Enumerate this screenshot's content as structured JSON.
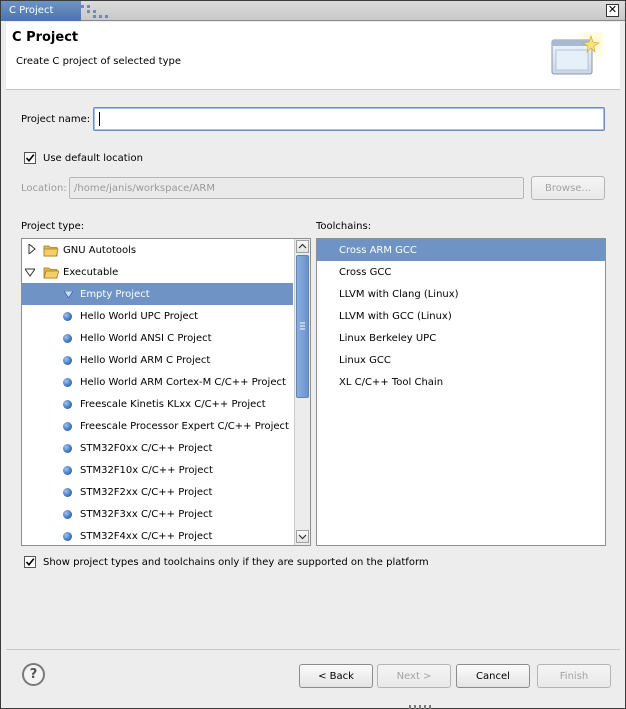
{
  "window": {
    "title": "C Project",
    "close_glyph": "✕"
  },
  "header": {
    "title": "C Project",
    "description": "Create C project of selected type",
    "banner_icon": "wizard-banner-icon"
  },
  "form": {
    "project_name_label": "Project name:",
    "project_name_value": "",
    "use_default_label": "Use default location",
    "use_default_checked": true,
    "location_label": "Location:",
    "location_value": "/home/janis/workspace/ARM",
    "browse_label": "Browse...",
    "project_type_label": "Project type:",
    "toolchains_label": "Toolchains:",
    "show_supported_label": "Show project types and toolchains only if they are supported on the platform",
    "show_supported_checked": true
  },
  "project_types": [
    {
      "label": "GNU Autotools",
      "kind": "folder",
      "expanded": false
    },
    {
      "label": "Executable",
      "kind": "folder",
      "expanded": true
    },
    {
      "label": "Empty Project",
      "kind": "item",
      "selected": true
    },
    {
      "label": "Hello World UPC Project",
      "kind": "item"
    },
    {
      "label": "Hello World ANSI C Project",
      "kind": "item"
    },
    {
      "label": "Hello World ARM C Project",
      "kind": "item"
    },
    {
      "label": "Hello World ARM Cortex-M C/C++ Project",
      "kind": "item"
    },
    {
      "label": "Freescale Kinetis KLxx C/C++ Project",
      "kind": "item"
    },
    {
      "label": "Freescale Processor Expert C/C++ Project",
      "kind": "item"
    },
    {
      "label": "STM32F0xx C/C++ Project",
      "kind": "item"
    },
    {
      "label": "STM32F10x C/C++ Project",
      "kind": "item"
    },
    {
      "label": "STM32F2xx C/C++ Project",
      "kind": "item"
    },
    {
      "label": "STM32F3xx C/C++ Project",
      "kind": "item"
    },
    {
      "label": "STM32F4xx C/C++ Project",
      "kind": "item"
    }
  ],
  "toolchains": [
    {
      "label": "Cross ARM GCC",
      "selected": true
    },
    {
      "label": "Cross GCC"
    },
    {
      "label": "LLVM with Clang (Linux)"
    },
    {
      "label": "LLVM with GCC (Linux)"
    },
    {
      "label": "Linux Berkeley UPC"
    },
    {
      "label": "Linux GCC"
    },
    {
      "label": "XL C/C++ Tool Chain"
    }
  ],
  "buttons": {
    "help": "?",
    "back": "< Back",
    "next": "Next >",
    "cancel": "Cancel",
    "finish": "Finish"
  },
  "colors": {
    "selection": "#6f93c4",
    "title_tab": "#4c74ad"
  }
}
